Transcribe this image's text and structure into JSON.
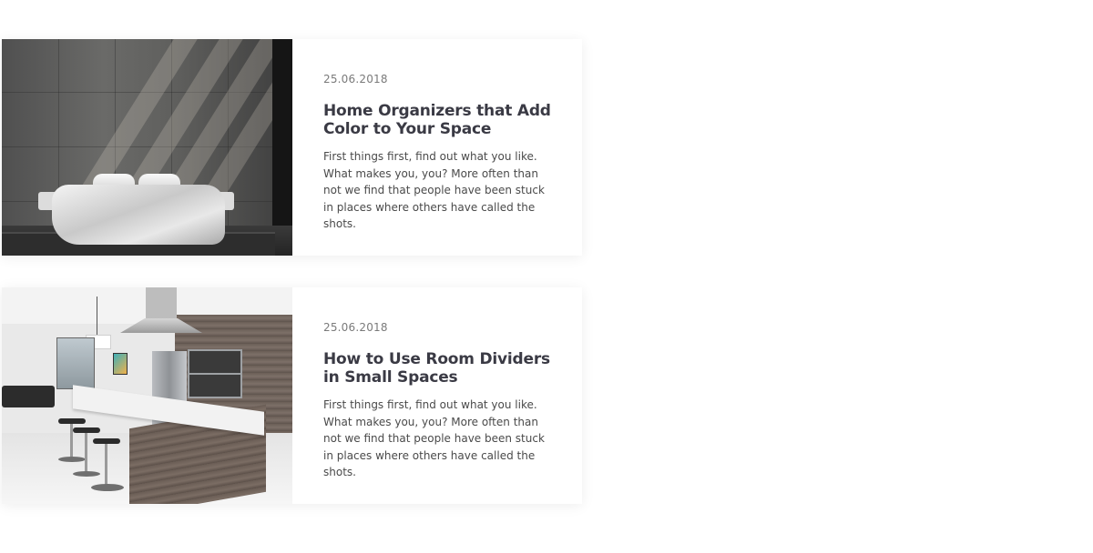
{
  "posts": [
    {
      "date": "25.06.2018",
      "title": "Home Organizers that Add Color to Your Space",
      "excerpt": "First things first, find out what you like. What makes you, you? More often than not we find that people have been stuck in places where others have called the shots.",
      "image": "bedroom-photo"
    },
    {
      "date": "25.06.2018",
      "title": "How to Use Room Dividers in Small Spaces",
      "excerpt": "First things first, find out what you like. What makes you, you? More often than not we find that people have been stuck in places where others have called the shots.",
      "image": "kitchen-photo"
    }
  ],
  "colors": {
    "title": "#3a3a44",
    "date": "#7a7a7a",
    "text": "#4a4a4a",
    "card_bg": "#ffffff"
  }
}
